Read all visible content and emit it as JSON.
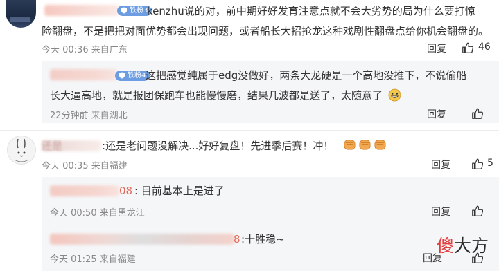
{
  "comments": [
    {
      "badge": "铁粉3",
      "text_lines": [
        "kenzhu说的对，前中期好好发育注意点就不会大劣势的局为什么要打惊",
        "险翻盘，不是把把对面优势都会出现问题，或者船长大招抢龙这种戏剧性翻盘点给你机会翻盘的。"
      ],
      "time": "今天 00:36 来自广东",
      "reply_label": "回复",
      "like_count": "46",
      "replies": [
        {
          "badge": "铁粉4",
          "text_lines": [
            "这把感觉纯属于edg没做好，两条大龙硬是一个高地没推下，不说偷船",
            "长大逼高地，就是报团保跑车也能慢慢磨，结果几波都是送了，太随意了"
          ],
          "time": "22分钟前 来自湖北",
          "reply_label": "回复"
        }
      ]
    },
    {
      "name_fragment": "还是",
      "text": "还是老问题没解决...好好复盘！先进季后赛！冲！",
      "time": "今天 00:35 来自福建",
      "reply_label": "回复",
      "like_count": "5",
      "replies": [
        {
          "name_suffix": "08",
          "text": "目前基本上是进了",
          "time": "今天 00:50 来自黑龙江",
          "reply_label": "回复"
        },
        {
          "name_suffix": "8",
          "text": "十胜稳~",
          "time": "今天 01:25 来自福建",
          "reply_label": "回复"
        }
      ]
    }
  ],
  "watermark": {
    "char1": "傻",
    "char2": "大方",
    "color1": "#e23d3d",
    "color2": "#2a2a2a"
  },
  "colors": {
    "badge": "#6c9de2",
    "meta": "#888888",
    "reply_bg": "#f5f6f8",
    "emoji": "#f0a64b"
  },
  "icons": [
    "thumbs-up-icon",
    "fan-badge-icon",
    "fist-emoji",
    "grin-sweat-emoji",
    "rabbit-avatar"
  ]
}
